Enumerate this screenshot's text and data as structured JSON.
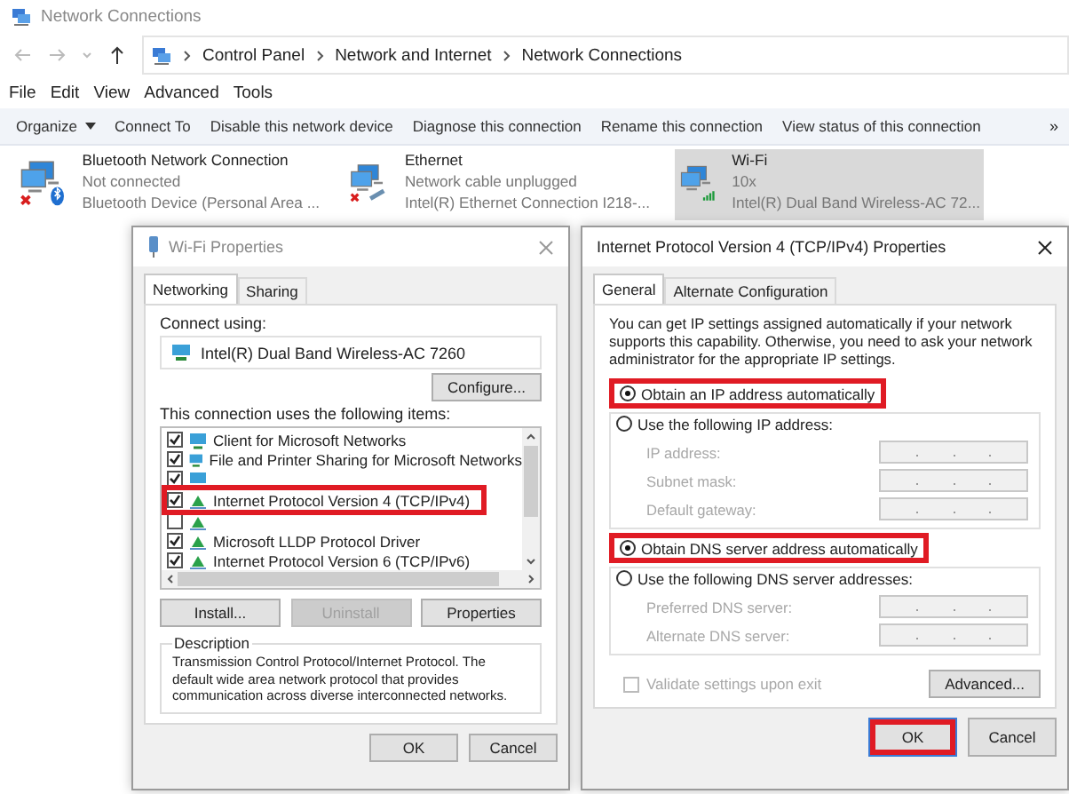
{
  "window": {
    "title": "Network Connections"
  },
  "address_bar": {
    "path": [
      "Control Panel",
      "Network and Internet",
      "Network Connections"
    ]
  },
  "menu": [
    "File",
    "Edit",
    "View",
    "Advanced",
    "Tools"
  ],
  "toolbar": {
    "items": [
      "Organize",
      "Connect To",
      "Disable this network device",
      "Diagnose this connection",
      "Rename this connection",
      "View status of this connection"
    ],
    "overflow": "»"
  },
  "connections": [
    {
      "kind": "bluetooth",
      "name": "Bluetooth Network Connection",
      "status": "Not connected",
      "device": "Bluetooth Device (Personal Area ...",
      "connected": false,
      "selected": false
    },
    {
      "kind": "ethernet",
      "name": "Ethernet",
      "status": "Network cable unplugged",
      "device": "Intel(R) Ethernet Connection I218-...",
      "connected": false,
      "selected": false
    },
    {
      "kind": "wifi",
      "name": "Wi-Fi",
      "status": "10x",
      "device": "Intel(R) Dual Band Wireless-AC 72...",
      "connected": true,
      "selected": true
    }
  ],
  "wifi_properties": {
    "title": "Wi-Fi Properties",
    "tabs": [
      {
        "label": "Networking",
        "selected": true
      },
      {
        "label": "Sharing",
        "selected": false
      }
    ],
    "connect_using_label": "Connect using:",
    "adapter": "Intel(R) Dual Band Wireless-AC 7260",
    "configure_button": "Configure...",
    "items_label": "This connection uses the following items:",
    "items": [
      {
        "kind": "client",
        "label": "Client for Microsoft Networks",
        "checked": true,
        "highlighted": false
      },
      {
        "kind": "client",
        "label": "File and Printer Sharing for Microsoft Networks",
        "checked": true,
        "highlighted": false
      },
      {
        "kind": "client",
        "checked": true,
        "highlighted": false
      },
      {
        "kind": "protocol",
        "label": "Internet Protocol Version 4 (TCP/IPv4)",
        "checked": true,
        "highlighted": true
      },
      {
        "kind": "protocol",
        "checked": false,
        "highlighted": false
      },
      {
        "kind": "protocol",
        "label": "Microsoft LLDP Protocol Driver",
        "checked": true,
        "highlighted": false
      },
      {
        "kind": "protocol",
        "label": "Internet Protocol Version 6 (TCP/IPv6)",
        "checked": true,
        "highlighted": false
      }
    ],
    "buttons": [
      {
        "label": "Install...",
        "disabled": false
      },
      {
        "label": "Uninstall",
        "disabled": true
      },
      {
        "label": "Properties",
        "disabled": false
      }
    ],
    "description_label": "Description",
    "description": "Transmission Control Protocol/Internet Protocol. The default wide area network protocol that provides communication across diverse interconnected networks.",
    "dialog_buttons": [
      {
        "label": "OK",
        "highlighted": false
      },
      {
        "label": "Cancel",
        "highlighted": false
      }
    ]
  },
  "ipv4_properties": {
    "title": "Internet Protocol Version 4 (TCP/IPv4) Properties",
    "tabs": [
      {
        "label": "General",
        "selected": true
      },
      {
        "label": "Alternate Configuration",
        "selected": false
      }
    ],
    "intro": "You can get IP settings assigned automatically if your network supports this capability. Otherwise, you need to ask your network administrator for the appropriate IP settings.",
    "ip_options": [
      {
        "label": "Obtain an IP address automatically",
        "selected": true,
        "highlighted": true
      },
      {
        "label": "Use the following IP address:",
        "selected": false,
        "highlighted": false
      }
    ],
    "ip_fields": [
      {
        "label": "IP address:",
        "disabled": true
      },
      {
        "label": "Subnet mask:",
        "disabled": true
      },
      {
        "label": "Default gateway:",
        "disabled": true
      }
    ],
    "dns_options": [
      {
        "label": "Obtain DNS server address automatically",
        "selected": true,
        "highlighted": true
      },
      {
        "label": "Use the following DNS server addresses:",
        "selected": false,
        "highlighted": false
      }
    ],
    "dns_fields": [
      {
        "label": "Preferred DNS server:",
        "disabled": true
      },
      {
        "label": "Alternate DNS server:",
        "disabled": true
      }
    ],
    "validate": {
      "label": "Validate settings upon exit",
      "checked": false,
      "disabled": true
    },
    "advanced_button": "Advanced...",
    "dialog_buttons": [
      {
        "label": "OK",
        "highlighted": true
      },
      {
        "label": "Cancel",
        "highlighted": false
      }
    ]
  }
}
